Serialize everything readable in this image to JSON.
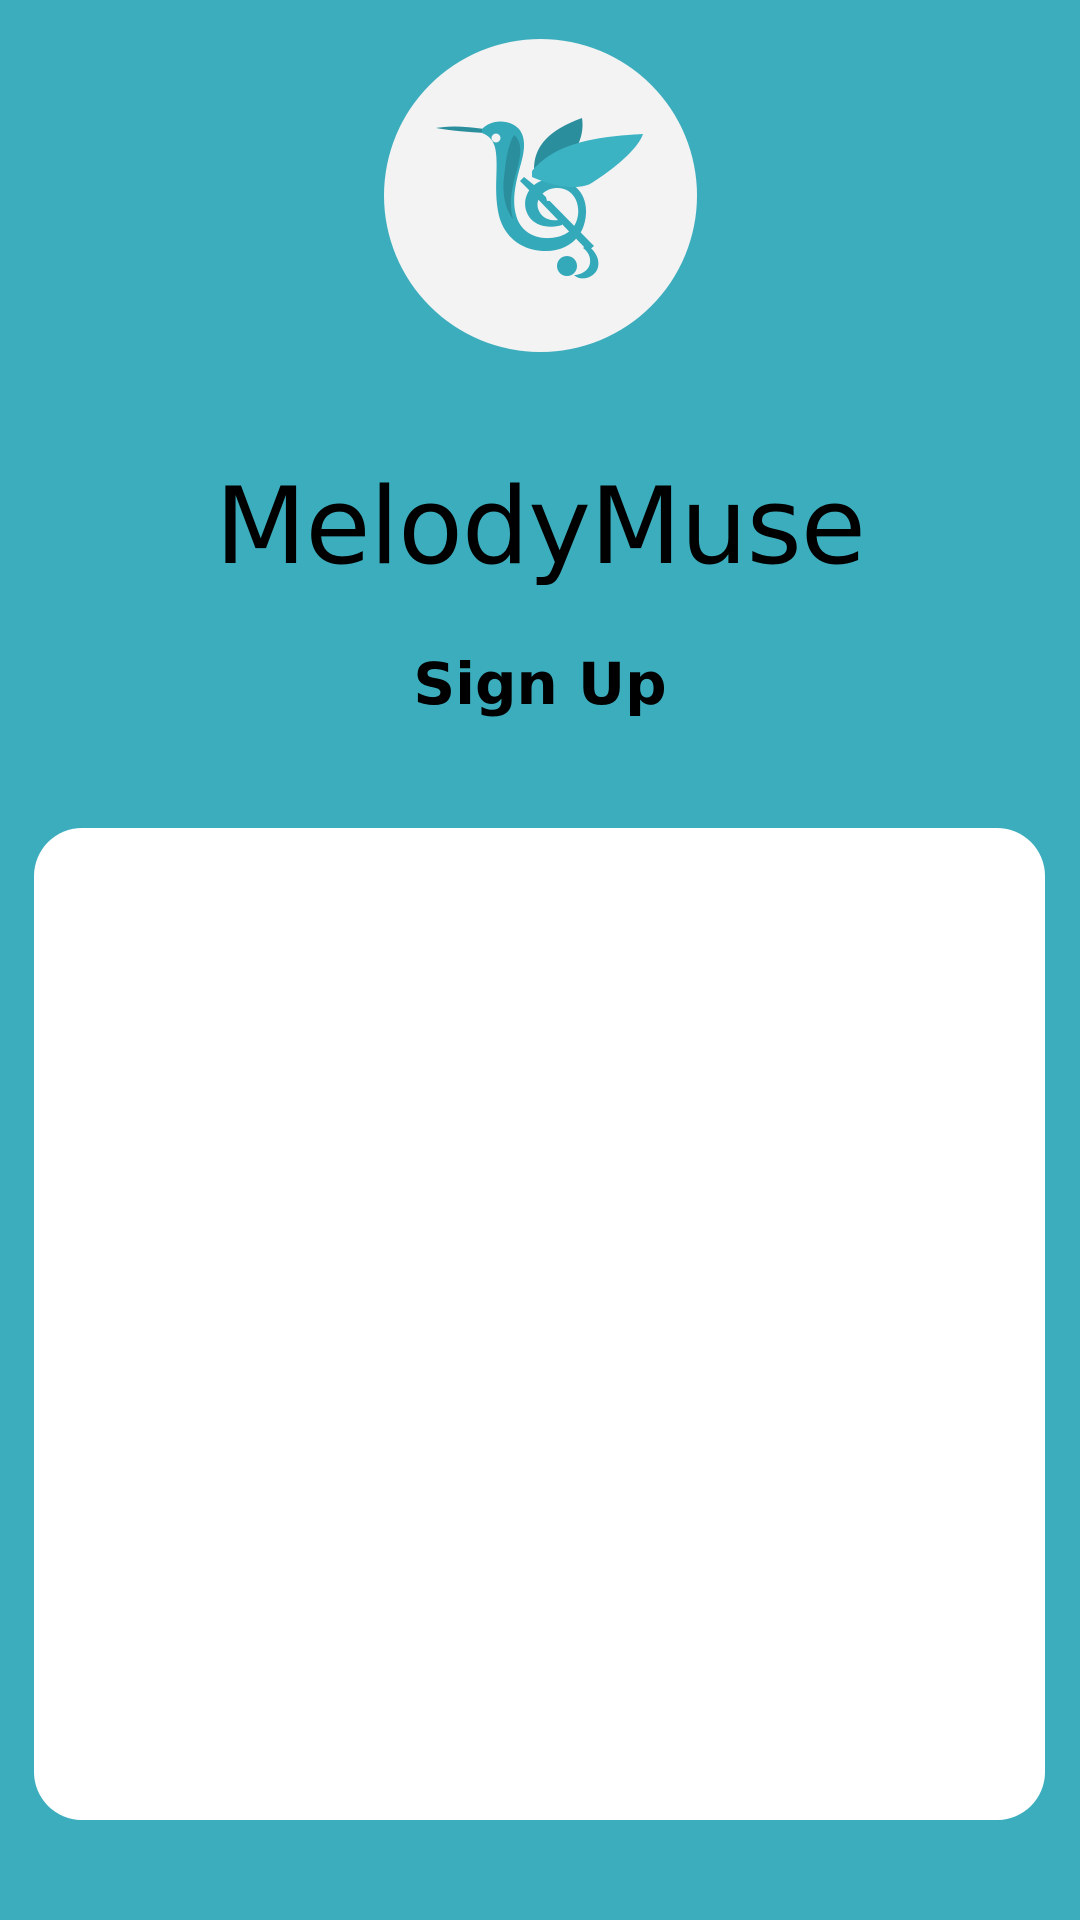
{
  "app": {
    "name": "MelodyMuse",
    "logo_icon": "hummingbird-treble-clef-icon"
  },
  "page": {
    "heading": "Sign Up"
  },
  "colors": {
    "background": "#3BADBD",
    "logo_circle": "#F3F3F3",
    "card": "#FFFFFF",
    "logo_primary": "#33A9BA",
    "logo_dark": "#2A8E9D",
    "text": "#000000"
  }
}
